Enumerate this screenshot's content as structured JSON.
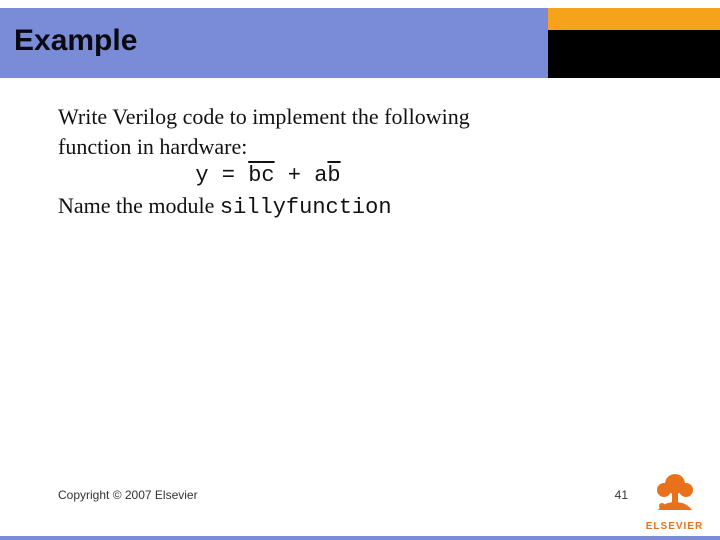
{
  "title": "Example",
  "body": {
    "line1": "Write Verilog code to implement the following",
    "line2": "function in hardware:",
    "eq_lhs": "y = ",
    "eq_term1a": "b",
    "eq_term1b": "c",
    "eq_plus": " + ",
    "eq_term2a": "a",
    "eq_term2b": "b",
    "line3_pre": "Name the module ",
    "line3_code": "sillyfunction"
  },
  "copyright": "Copyright © 2007 Elsevier",
  "page_number": "41",
  "logo": {
    "brand": "ELSEVIER",
    "fill": "#e9711c"
  }
}
